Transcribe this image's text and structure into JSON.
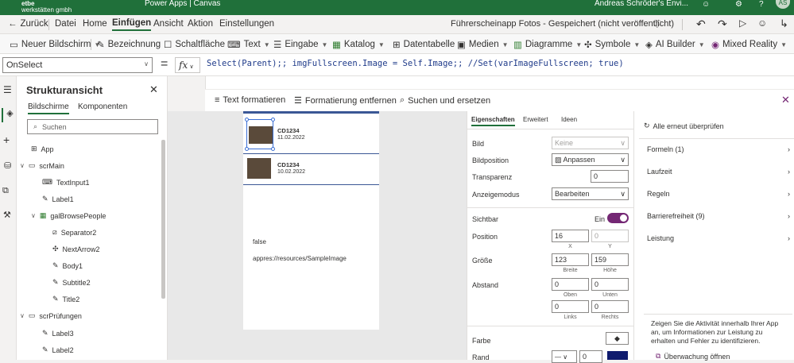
{
  "topbar": {
    "logo": "werkstätten gmbh",
    "app": "Power Apps | Canvas",
    "user": "Andreas Schröder's Envi...",
    "avatar": "AS"
  },
  "cmdbar": {
    "back": "Zurück",
    "menus": [
      "Datei",
      "Home",
      "Einfügen",
      "Ansicht",
      "Aktion",
      "Einstellungen"
    ],
    "active": "Einfügen",
    "doc_title": "Führerscheinapp Fotos - Gespeichert (nicht veröffentlicht)"
  },
  "ribbon": {
    "items": [
      "Neuer Bildschirm",
      "Bezeichnung",
      "Schaltfläche",
      "Text",
      "Eingabe",
      "Katalog",
      "Datentabelle",
      "Medien",
      "Diagramme",
      "Symbole",
      "AI Builder",
      "Mixed Reality"
    ]
  },
  "formula": {
    "property": "OnSelect",
    "fx": "fx",
    "text": "Select(Parent);; imgFullscreen.Image = Self.Image;; //Set(varImageFullscreen; true)"
  },
  "formula_tools": {
    "format": "Text formatieren",
    "remove": "Formatierung entfernen",
    "find": "Suchen und ersetzen"
  },
  "tree": {
    "title": "Strukturansicht",
    "tab1": "Bildschirme",
    "tab2": "Komponenten",
    "search": "Suchen",
    "nodes": [
      "App",
      "scrMain",
      "TextInput1",
      "Label1",
      "galBrowsePeople",
      "Separator2",
      "NextArrow2",
      "Body1",
      "Subtitle2",
      "Title2",
      "scrPrüfungen",
      "Label3",
      "Label2"
    ]
  },
  "canvas": {
    "rows": [
      {
        "id": "CD1234",
        "date": "11.02.2022"
      },
      {
        "id": "CD1234",
        "date": "10.02.2022"
      }
    ],
    "text1": "false",
    "text2": "appres://resources/SampleImage"
  },
  "props": {
    "tabs": [
      "Eigenschaften",
      "Erweitert",
      "Ideen"
    ],
    "bild_label": "Bild",
    "bild": "Keine",
    "pos_label": "Bildposition",
    "pos": "Anpassen",
    "trans_label": "Transparenz",
    "trans": "0",
    "mode_label": "Anzeigemodus",
    "mode": "Bearbeiten",
    "vis_label": "Sichtbar",
    "vis": "Ein",
    "position_label": "Position",
    "x": "16",
    "y": "0",
    "xl": "X",
    "yl": "Y",
    "size_label": "Größe",
    "w": "123",
    "h": "159",
    "wl": "Breite",
    "hl": "Höhe",
    "pad_label": "Abstand",
    "pt": "0",
    "pb": "0",
    "pl": "0",
    "pr": "0",
    "ptl": "Oben",
    "pbl": "Unten",
    "pll": "Links",
    "prl": "Rechts",
    "color_label": "Farbe",
    "border_label": "Rand",
    "border_w": "0"
  },
  "right": {
    "recheck": "Alle erneut überprüfen",
    "rows": [
      "Formeln (1)",
      "Laufzeit",
      "Regeln",
      "Barrierefreiheit (9)",
      "Leistung"
    ],
    "info": "Zeigen Sie die Aktivität innerhalb Ihrer App an, um Informationen zur Leistung zu erhalten und Fehler zu identifizieren.",
    "monitor": "Überwachung öffnen"
  },
  "colors": {
    "brand": "#20703a",
    "accent": "#742774",
    "border_color": "#0f1b6e"
  }
}
